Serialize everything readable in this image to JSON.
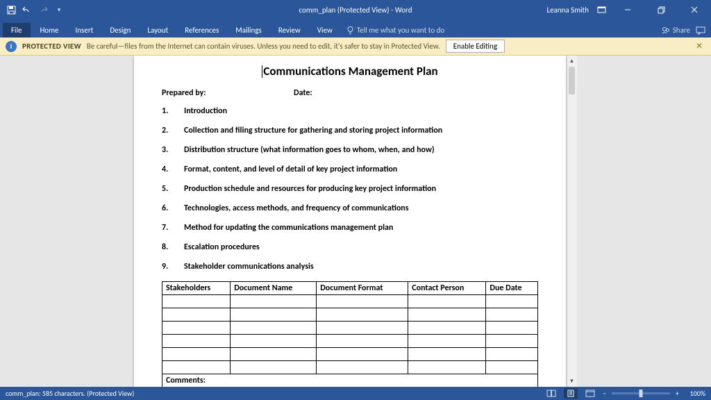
{
  "titlebar": {
    "doc_title": "comm_plan (Protected View) - Word",
    "user": "Leanna Smith"
  },
  "ribbon": {
    "tabs": [
      "File",
      "Home",
      "Insert",
      "Design",
      "Layout",
      "References",
      "Mailings",
      "Review",
      "View"
    ],
    "tell_me": "Tell me what you want to do",
    "share": "Share"
  },
  "protected": {
    "label": "PROTECTED VIEW",
    "msg": "Be careful—files from the Internet can contain viruses. Unless you need to edit, it's safer to stay in Protected View.",
    "button": "Enable Editing"
  },
  "document": {
    "title": "Communications Management Plan",
    "prepared_label": "Prepared by:",
    "date_label": "Date:",
    "sections": [
      "Introduction",
      "Collection and filing structure for gathering and storing project information",
      "Distribution structure (what information goes to whom, when, and how)",
      "Format, content, and level of detail of key project information",
      "Production schedule and resources for producing key project information",
      "Technologies, access methods, and frequency of communications",
      "Method for updating the communications management plan",
      "Escalation procedures",
      "Stakeholder communications analysis"
    ],
    "table": {
      "headers": [
        "Stakeholders",
        "Document Name",
        "Document Format",
        "Contact Person",
        "Due Date"
      ],
      "empty_rows": 6,
      "comments_label": "Comments:"
    }
  },
  "status": {
    "left": "comm_plan: 585 characters.  (Protected View)",
    "zoom": "100%"
  }
}
